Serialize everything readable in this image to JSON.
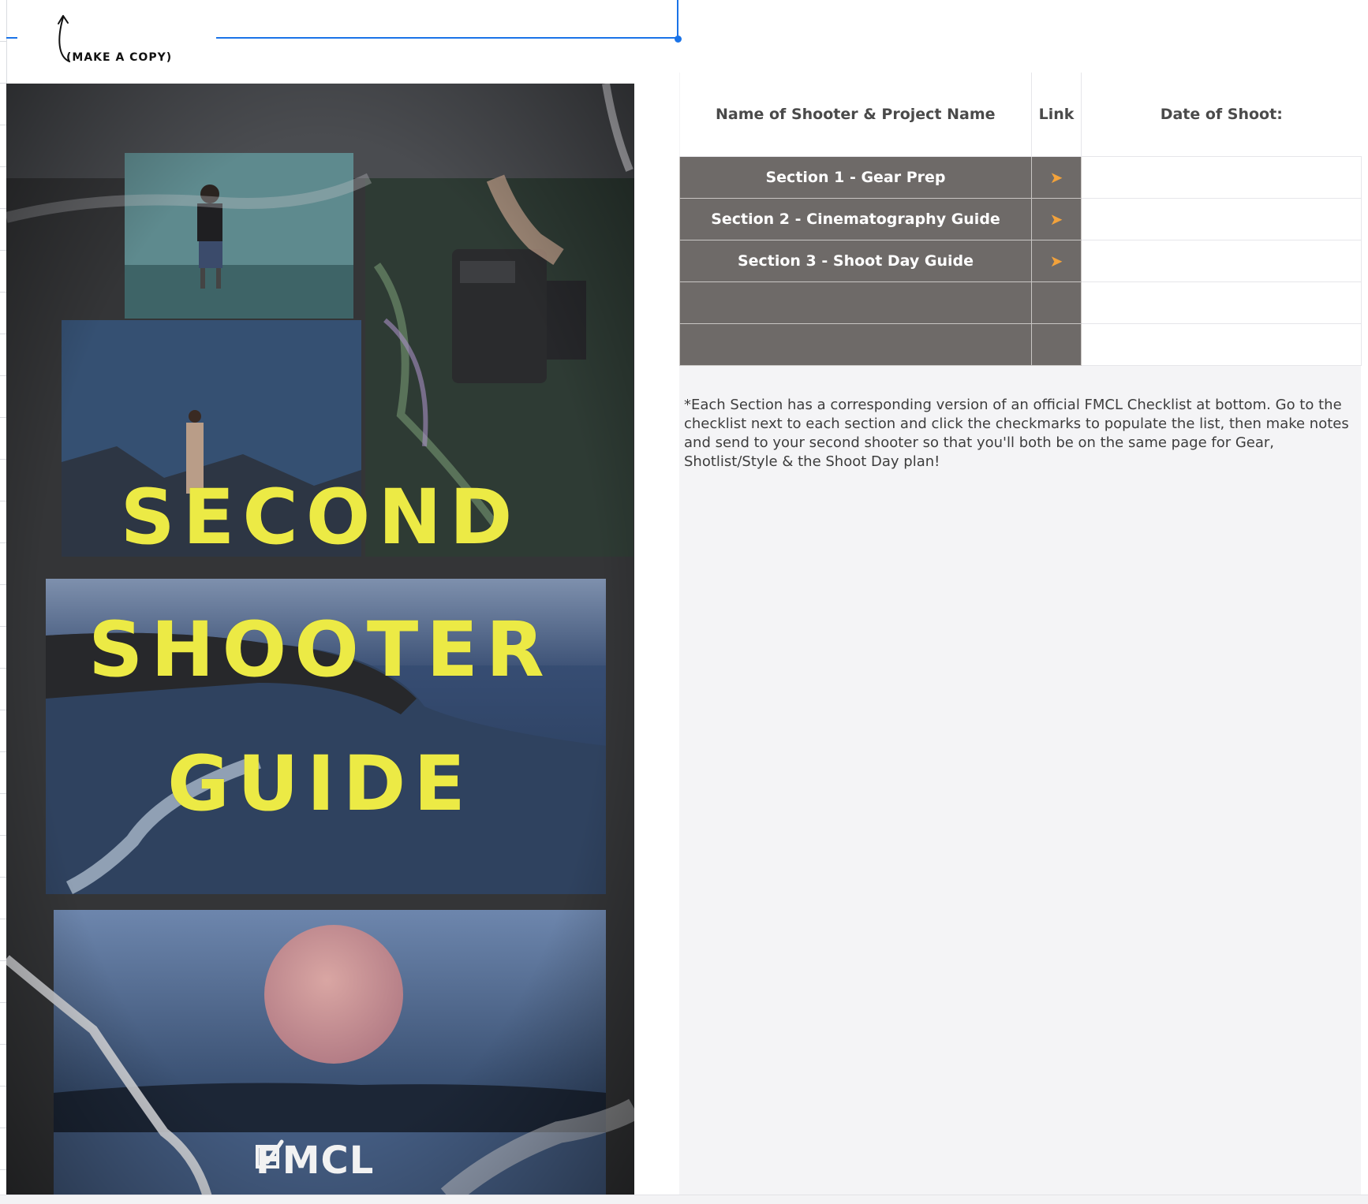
{
  "note": {
    "make_copy_label": "(MAKE A COPY)"
  },
  "table": {
    "headers": {
      "name": "Name of Shooter & Project Name",
      "link": "Link",
      "date": "Date of Shoot:"
    },
    "rows": [
      {
        "name": "Section 1 - Gear Prep",
        "link": "➤",
        "date": ""
      },
      {
        "name": "Section 2 - Cinematography Guide",
        "link": "➤",
        "date": ""
      },
      {
        "name": "Section 3 - Shoot Day Guide",
        "link": "➤",
        "date": ""
      },
      {
        "name": "",
        "link": "",
        "date": ""
      },
      {
        "name": "",
        "link": "",
        "date": ""
      }
    ]
  },
  "footnote": "*Each Section has a corresponding version of an official FMCL Checklist at bottom. Go to the checklist next to each section and click the checkmarks to populate the list, then make notes and send to your second shooter so that you'll both be on the same page for Gear, Shotlist/Style & the Shoot Day plan!",
  "poster": {
    "title_line_1": "SECOND",
    "title_line_2": "SHOOTER",
    "title_line_3": "GUIDE",
    "brand": "FMCL",
    "title_color": "#ecea45"
  },
  "colors": {
    "section_cell": "#6e6a68",
    "arrow": "#f2a23b",
    "selection": "#1a73e8"
  },
  "icons": {
    "link_arrow": "arrow-right-icon",
    "copy_arrow": "curved-arrow-up-icon",
    "brand_check": "checkbox-check-icon"
  }
}
